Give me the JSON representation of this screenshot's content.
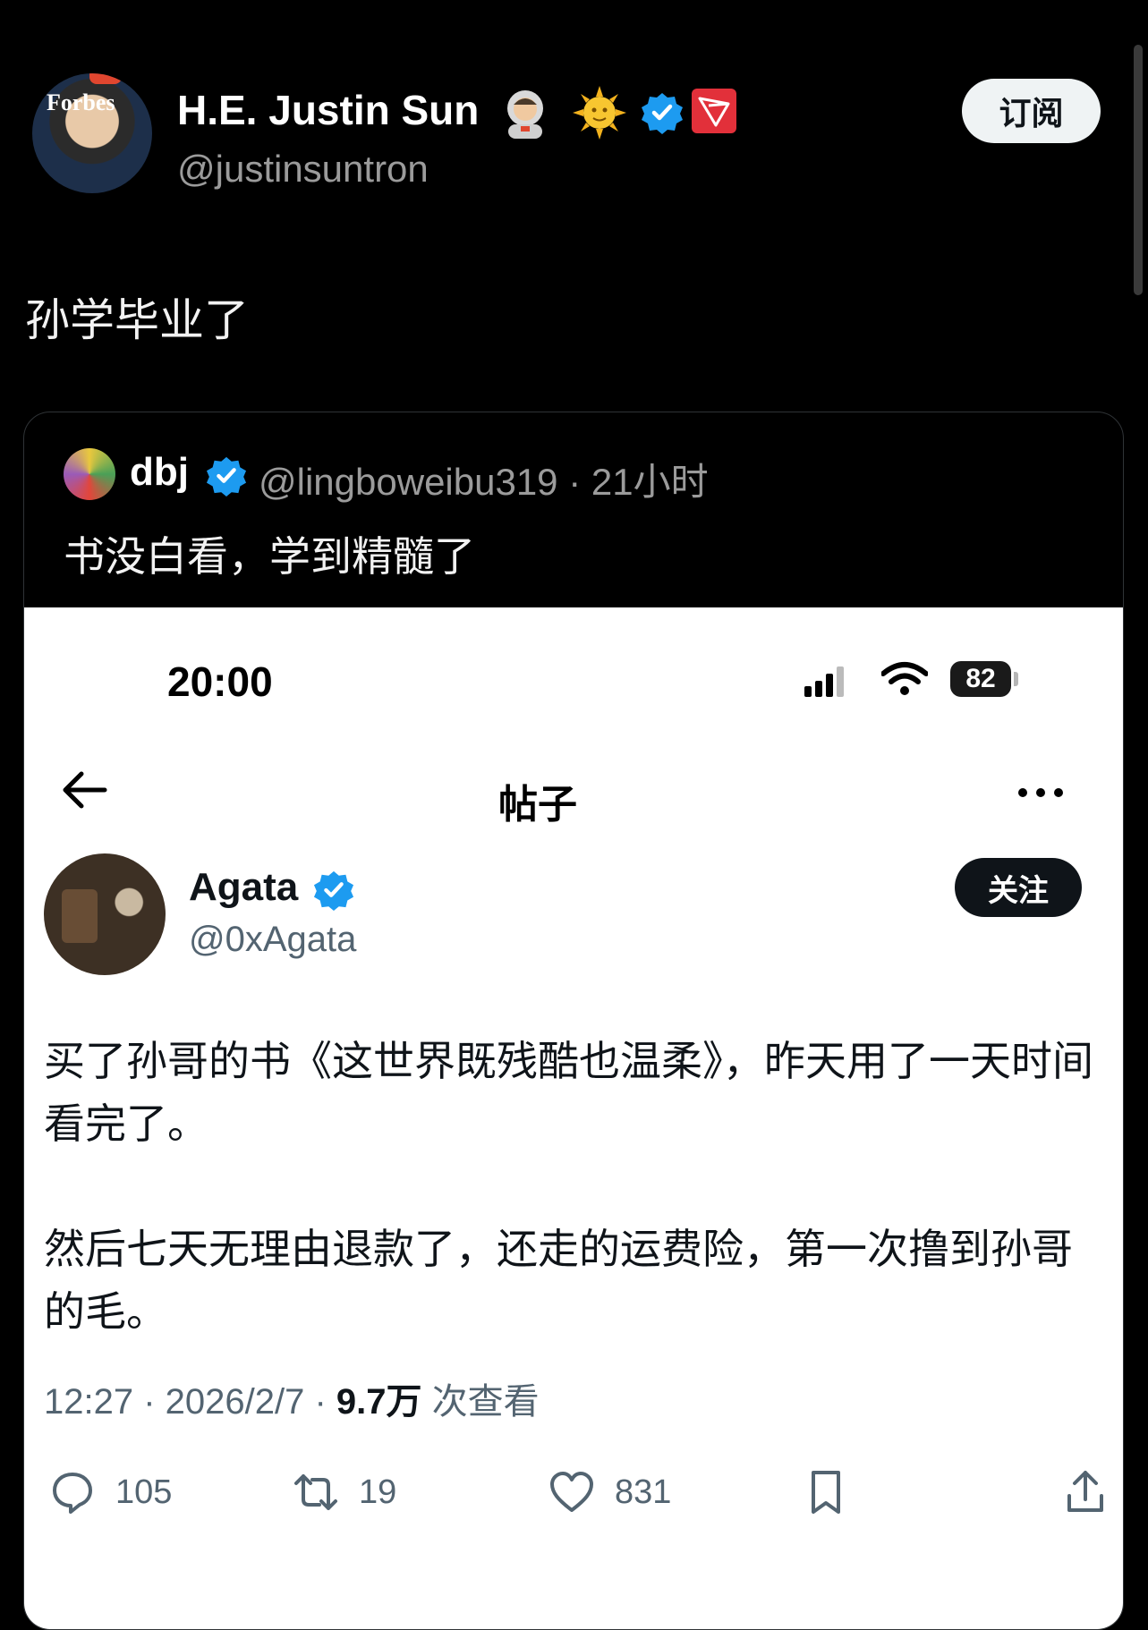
{
  "header": {
    "display_name": "H.E. Justin Sun",
    "handle": "@justinsuntron",
    "subscribe_label": "订阅",
    "avatar_logo_text": "Forbes",
    "badges": [
      "astronaut-emoji",
      "sun-emoji",
      "verified-icon",
      "tron-icon"
    ]
  },
  "post": {
    "text": "孙学毕业了"
  },
  "quote": {
    "name": "dbj",
    "handle_time": "@lingboweibu319 · 21小时",
    "text": "书没白看，学到精髓了"
  },
  "embedded": {
    "status_time": "20:00",
    "battery": "82",
    "nav_title": "帖子",
    "author_name": "Agata",
    "author_handle": "@0xAgata",
    "follow_label": "关注",
    "body": [
      "买了孙哥的书《这世界既残酷也温柔》，昨天用了一天时间看完了。",
      "然后七天无理由退款了，还走的运费险，第一次撸到孙哥的毛。"
    ],
    "meta_time": "12:27 · 2026/2/7 · ",
    "meta_views": "9.7万",
    "meta_views_label": " 次查看",
    "actions": {
      "replies": "105",
      "retweets": "19",
      "likes": "831"
    }
  },
  "colors": {
    "background": "#000000",
    "verified": "#1d9bf0",
    "tron_red": "#e2303a"
  }
}
